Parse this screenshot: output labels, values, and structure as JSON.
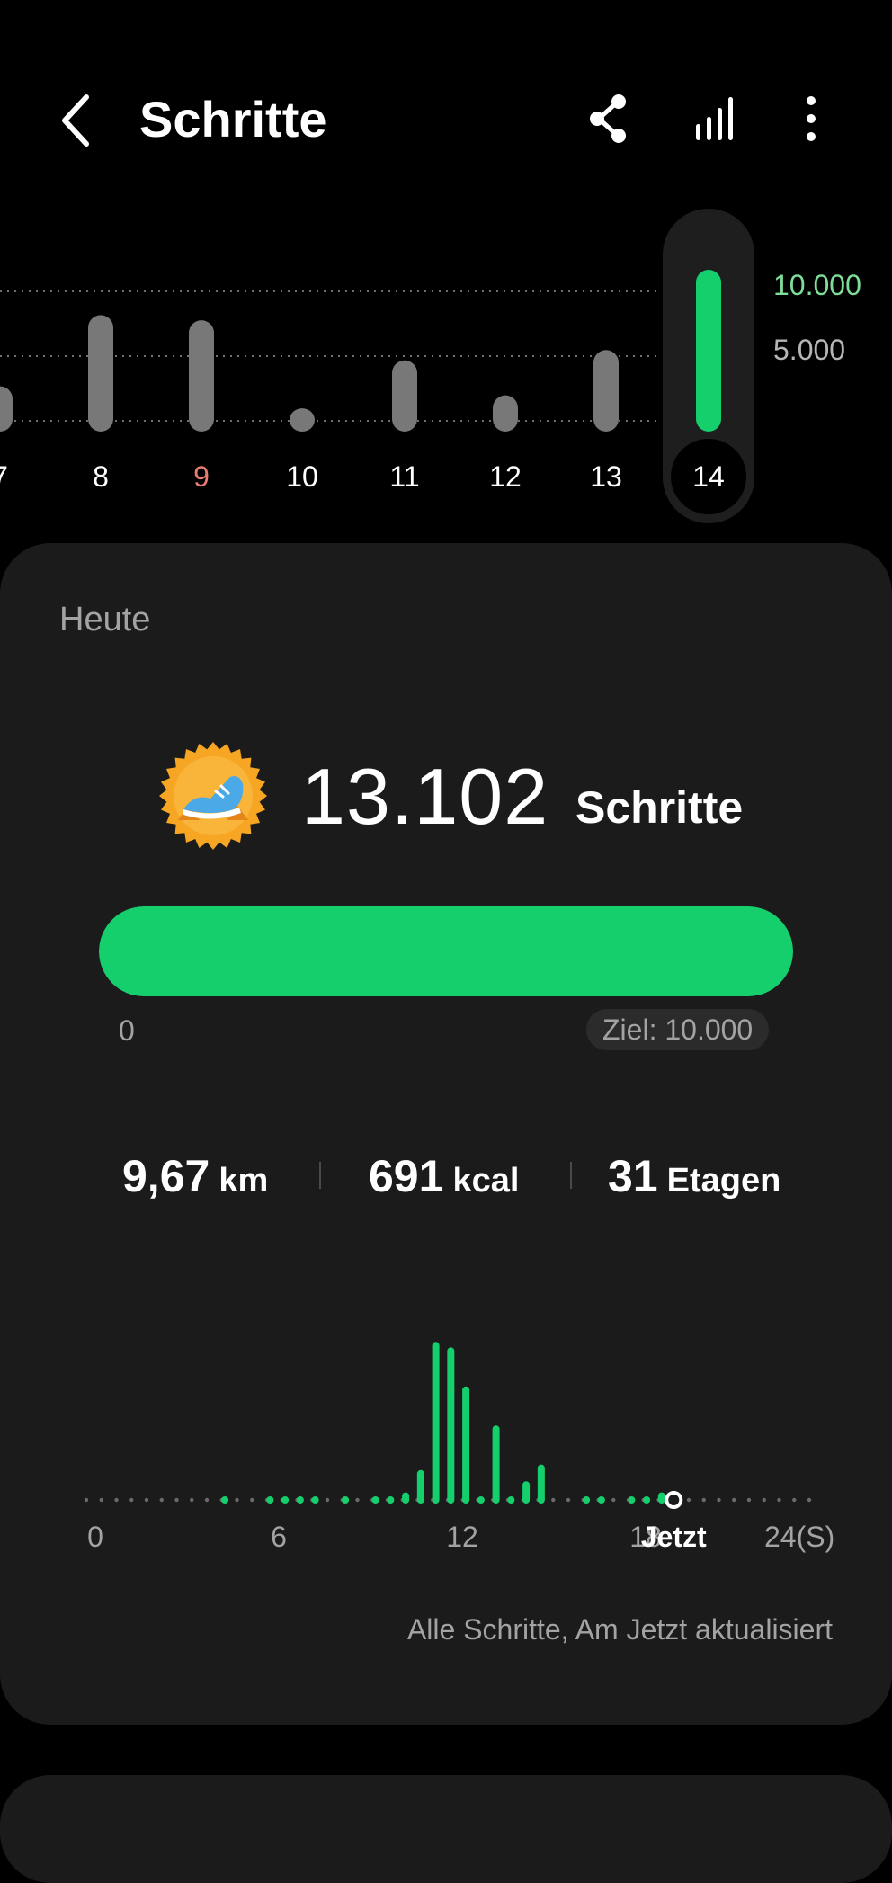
{
  "header": {
    "title": "Schritte",
    "back_icon": "chevron-left-icon",
    "share_icon": "share-icon",
    "stats_icon": "signal-bars-icon",
    "more_icon": "more-vertical-icon"
  },
  "weekly_chart": {
    "days": [
      "7",
      "8",
      "9",
      "10",
      "11",
      "12",
      "13",
      "14"
    ],
    "highlight_day": "9",
    "selected_day": "14",
    "values": [
      3500,
      9000,
      8600,
      1800,
      5500,
      2800,
      6300,
      13102
    ],
    "ticks": [
      "10.000",
      "5.000"
    ],
    "goal_label": "10.000",
    "goal_color": "#7ddc9a",
    "highlight_color": "#e77c72"
  },
  "today": {
    "label": "Heute",
    "badge_icon": "running-shoe-badge-icon",
    "steps": "13.102",
    "steps_unit": "Schritte",
    "progress_fraction": 1.0,
    "progress_min": "0",
    "goal_text": "Ziel: 10.000",
    "accent_color": "#15cf6c"
  },
  "metrics": [
    {
      "value": "9,67",
      "unit": "km"
    },
    {
      "value": "691",
      "unit": "kcal"
    },
    {
      "value": "31",
      "unit": "Etagen"
    }
  ],
  "chart_data": {
    "type": "bar",
    "x_ticks": [
      "0",
      "6",
      "12",
      "18",
      "24(S)"
    ],
    "now_label": "Jetzt",
    "now_hour": 19.5,
    "bar_color": "#15cf6c",
    "bars": [
      {
        "hour": 4.6,
        "value": 1
      },
      {
        "hour": 6.1,
        "value": 1
      },
      {
        "hour": 6.6,
        "value": 1
      },
      {
        "hour": 7.1,
        "value": 1
      },
      {
        "hour": 7.6,
        "value": 1
      },
      {
        "hour": 8.6,
        "value": 1
      },
      {
        "hour": 9.6,
        "value": 1
      },
      {
        "hour": 10.1,
        "value": 1
      },
      {
        "hour": 10.6,
        "value": 2
      },
      {
        "hour": 11.1,
        "value": 6
      },
      {
        "hour": 11.6,
        "value": 29
      },
      {
        "hour": 12.1,
        "value": 28
      },
      {
        "hour": 12.6,
        "value": 21
      },
      {
        "hour": 13.1,
        "value": 1
      },
      {
        "hour": 13.6,
        "value": 14
      },
      {
        "hour": 14.1,
        "value": 1
      },
      {
        "hour": 14.6,
        "value": 4
      },
      {
        "hour": 15.1,
        "value": 7
      },
      {
        "hour": 16.6,
        "value": 1
      },
      {
        "hour": 17.1,
        "value": 1
      },
      {
        "hour": 18.1,
        "value": 1
      },
      {
        "hour": 18.6,
        "value": 1
      },
      {
        "hour": 19.1,
        "value": 2
      }
    ]
  },
  "footer_note": "Alle Schritte, Am Jetzt aktualisiert"
}
